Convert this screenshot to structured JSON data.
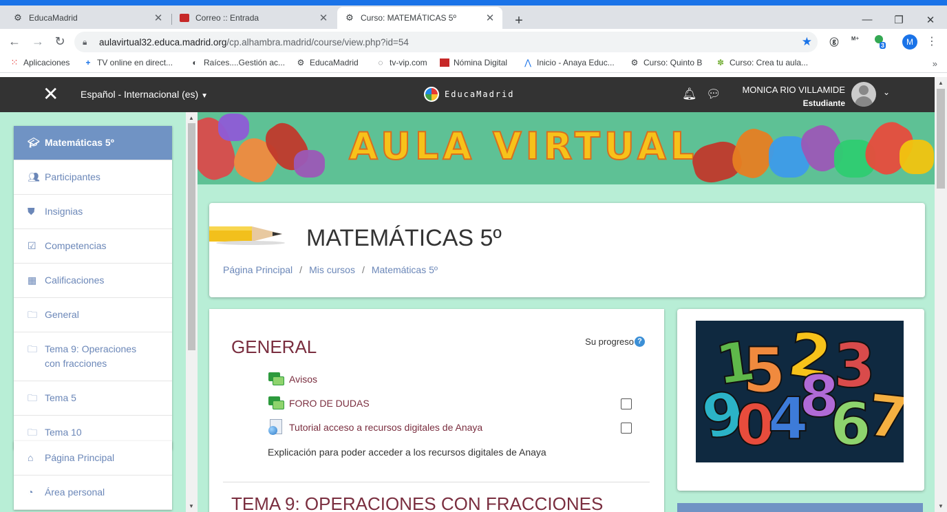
{
  "browser": {
    "tabs": [
      {
        "title": "EducaMadrid",
        "icon": "educamadrid-icon"
      },
      {
        "title": "Correo :: Entrada",
        "icon": "mail-icon"
      },
      {
        "title": "Curso: MATEMÁTICAS 5º",
        "icon": "educamadrid-icon"
      }
    ],
    "url_host": "aulavirtual32.educa.madrid.org",
    "url_path": "/cp.alhambra.madrid/course/view.php?id=54",
    "profile_initial": "M",
    "extension_badge": "3",
    "bookmarks": [
      {
        "label": "Aplicaciones",
        "icon": "apps-grid-icon"
      },
      {
        "label": "TV online en direct...",
        "icon": "plus-icon"
      },
      {
        "label": "Raíces....Gestión ac...",
        "icon": "globe-icon"
      },
      {
        "label": "EducaMadrid",
        "icon": "educamadrid-icon"
      },
      {
        "label": "tv-vip.com",
        "icon": "document-icon"
      },
      {
        "label": "Nómina Digital",
        "icon": "nomina-icon"
      },
      {
        "label": "Inicio - Anaya Educ...",
        "icon": "anaya-icon"
      },
      {
        "label": "Curso: Quinto B",
        "icon": "educamadrid-icon"
      },
      {
        "label": "Curso: Crea tu aula...",
        "icon": "sprout-icon"
      }
    ]
  },
  "navbar": {
    "language": "Español - Internacional (es)",
    "logo_text": "EducaMadrid",
    "user_name": "MONICA RIO VILLAMIDE",
    "user_role": "Estudiante"
  },
  "sidebar": {
    "items": [
      {
        "label": "Matemáticas 5º",
        "icon": "graduation-cap-icon",
        "active": true
      },
      {
        "label": "Participantes",
        "icon": "users-icon"
      },
      {
        "label": "Insignias",
        "icon": "shield-icon"
      },
      {
        "label": "Competencias",
        "icon": "checkbox-icon"
      },
      {
        "label": "Calificaciones",
        "icon": "table-icon"
      },
      {
        "label": "General",
        "icon": "folder-icon"
      },
      {
        "label": "Tema 9: Operaciones con fracciones",
        "icon": "folder-icon"
      },
      {
        "label": "Tema 5",
        "icon": "folder-icon"
      },
      {
        "label": "Tema 10",
        "icon": "folder-icon"
      }
    ],
    "items2": [
      {
        "label": "Página Principal",
        "icon": "home-icon"
      },
      {
        "label": "Área personal",
        "icon": "dashboard-icon"
      }
    ]
  },
  "banner": {
    "title": "AULA VIRTUAL"
  },
  "course": {
    "title": "MATEMÁTICAS 5º",
    "breadcrumb": [
      "Página Principal",
      "Mis cursos",
      "Matemáticas 5º"
    ]
  },
  "main": {
    "section_title": "GENERAL",
    "progress_label": "Su progreso",
    "activities": [
      {
        "label": "Avisos",
        "icon": "forum-icon",
        "has_checkbox": false
      },
      {
        "label": "FORO DE DUDAS",
        "icon": "forum-icon",
        "has_checkbox": true
      },
      {
        "label": "Tutorial acceso a recursos digitales de Anaya",
        "icon": "url-icon",
        "has_checkbox": true
      }
    ],
    "description": "Explicación para poder acceder a los recursos digitales de Anaya",
    "section2_title": "TEMA 9: OPERACIONES CON FRACCIONES"
  },
  "colors": {
    "accent": "#7093c4",
    "link": "#6b87b8",
    "section_title": "#7a2e3f",
    "page_bg": "#b8eed6",
    "navbar": "#333333"
  }
}
